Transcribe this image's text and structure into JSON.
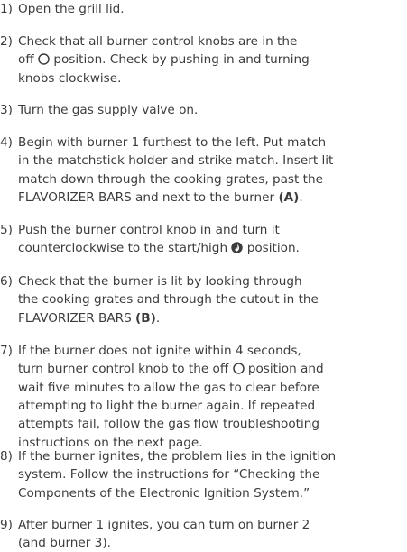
{
  "steps": [
    {
      "number": "1)",
      "lines": [
        {
          "segments": [
            {
              "text": "Open the grill lid."
            }
          ]
        }
      ]
    },
    {
      "number": "2)",
      "lines": [
        {
          "segments": [
            {
              "text": "Check that all burner control knobs are in the"
            }
          ]
        },
        {
          "segments": [
            {
              "text": "off "
            },
            {
              "icon": "off-circle-icon"
            },
            {
              "text": " position. Check by pushing in and turning"
            }
          ]
        },
        {
          "segments": [
            {
              "text": "knobs clockwise."
            }
          ]
        }
      ]
    },
    {
      "number": "3)",
      "lines": [
        {
          "segments": [
            {
              "text": "Turn the gas supply valve on."
            }
          ]
        }
      ]
    },
    {
      "number": "4)",
      "lines": [
        {
          "segments": [
            {
              "text": "Begin with burner 1 furthest to the left. Put match"
            }
          ]
        },
        {
          "segments": [
            {
              "text": "in the matchstick holder and strike match. Insert lit"
            }
          ]
        },
        {
          "segments": [
            {
              "text": "match down through the cooking grates, past the"
            }
          ]
        },
        {
          "segments": [
            {
              "text": "FLAVORIZER BARS and next to the burner "
            },
            {
              "text": "(A)",
              "bold": true
            },
            {
              "text": "."
            }
          ]
        }
      ]
    },
    {
      "number": "5)",
      "lines": [
        {
          "segments": [
            {
              "text": "Push the burner control knob in and turn it"
            }
          ]
        },
        {
          "segments": [
            {
              "text": "counterclockwise to the start/high "
            },
            {
              "icon": "start-high-flame-icon"
            },
            {
              "text": " position."
            }
          ]
        }
      ]
    },
    {
      "number": "6)",
      "lines": [
        {
          "segments": [
            {
              "text": "Check that the burner is lit by looking through"
            }
          ]
        },
        {
          "segments": [
            {
              "text": "the cooking grates and through the cutout in the"
            }
          ]
        },
        {
          "segments": [
            {
              "text": "FLAVORIZER BARS "
            },
            {
              "text": "(B)",
              "bold": true
            },
            {
              "text": "."
            }
          ]
        }
      ]
    },
    {
      "number": "7)",
      "lines": [
        {
          "segments": [
            {
              "text": "If the burner does not ignite within 4 seconds,"
            }
          ]
        },
        {
          "segments": [
            {
              "text": "turn burner control knob to the off "
            },
            {
              "icon": "off-circle-icon"
            },
            {
              "text": " position and"
            }
          ]
        },
        {
          "segments": [
            {
              "text": "wait five minutes to allow the gas to clear before"
            }
          ]
        },
        {
          "segments": [
            {
              "text": "attempting to light the burner again. If repeated"
            }
          ]
        },
        {
          "segments": [
            {
              "text": "attempts fail, follow the gas flow troubleshooting"
            }
          ]
        },
        {
          "segments": [
            {
              "text": "instructions on the next page."
            }
          ]
        }
      ]
    },
    {
      "number": "8)",
      "lines": [
        {
          "segments": [
            {
              "text": "If the burner ignites, the problem lies in the ignition"
            }
          ]
        },
        {
          "segments": [
            {
              "text": "system. Follow the instructions for “Checking the"
            }
          ]
        },
        {
          "segments": [
            {
              "text": "Components of the Electronic Ignition System.”"
            }
          ]
        }
      ]
    },
    {
      "number": "9)",
      "lines": [
        {
          "segments": [
            {
              "text": "After burner 1 ignites, you can turn on burner 2"
            }
          ]
        },
        {
          "segments": [
            {
              "text": "(and burner 3)."
            }
          ]
        }
      ]
    }
  ]
}
